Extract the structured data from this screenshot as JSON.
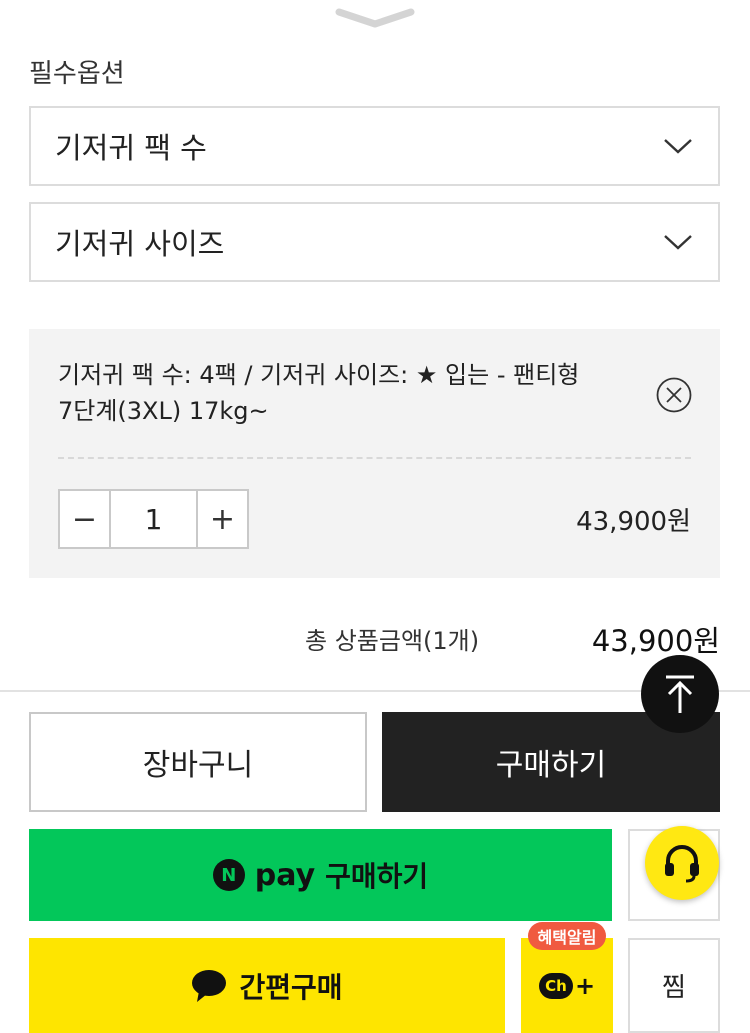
{
  "options": {
    "section_label": "필수옵션",
    "pack_select": {
      "label": "기저귀 팩 수"
    },
    "size_select": {
      "label": "기저귀 사이즈"
    }
  },
  "selected_item": {
    "description_line1": "기저귀 팩 수: 4팩 / 기저귀 사이즈: ★ 입는 - 팬티형",
    "description_line2": "7단계(3XL) 17kg~",
    "quantity": "1",
    "minus_label": "−",
    "plus_label": "+",
    "price": "43,900원"
  },
  "summary": {
    "total_label": "총 상품금액(1개)",
    "total_price": "43,900원"
  },
  "actions": {
    "cart_label": "장바구니",
    "buy_label": "구매하기",
    "npay_logo": "N",
    "npay_word": "pay",
    "npay_label": "구매하기",
    "kakao_label": "간편구매",
    "channel_badge": "혜택알림",
    "channel_logo": "Ch",
    "channel_plus": "+",
    "wish_label": "찜"
  },
  "colors": {
    "npay_green": "#03c75a",
    "kakao_yellow": "#fee500",
    "buy_dark": "#222222",
    "badge_red": "#f05a40",
    "panel_gray": "#f3f3f3"
  },
  "icons": [
    "chevron-down-icon",
    "close-circle-icon",
    "arrow-up-icon",
    "headset-icon",
    "chat-bubble-icon"
  ]
}
